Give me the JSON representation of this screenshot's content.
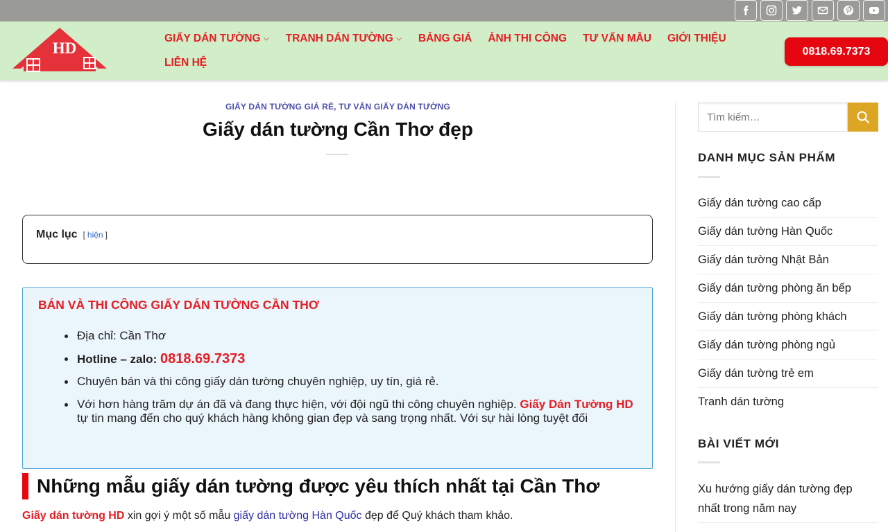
{
  "topbar": {
    "social": [
      {
        "icon": "facebook-icon",
        "name": "social-facebook"
      },
      {
        "icon": "instagram-icon",
        "name": "social-instagram"
      },
      {
        "icon": "twitter-icon",
        "name": "social-twitter"
      },
      {
        "icon": "email-icon",
        "name": "social-email"
      },
      {
        "icon": "pinterest-icon",
        "name": "social-pinterest"
      },
      {
        "icon": "youtube-icon",
        "name": "social-youtube"
      }
    ]
  },
  "header": {
    "logo_text": "HD",
    "nav": [
      {
        "label": "GIẤY DÁN TƯỜNG",
        "has_dropdown": true
      },
      {
        "label": "TRANH DÁN TƯỜNG",
        "has_dropdown": true
      },
      {
        "label": "BẢNG GIÁ",
        "has_dropdown": false
      },
      {
        "label": "ẢNH THI CÔNG",
        "has_dropdown": false
      },
      {
        "label": "TƯ VẤN MẪU",
        "has_dropdown": false
      },
      {
        "label": "GIỚI THIỆU",
        "has_dropdown": false
      },
      {
        "label": "LIÊN HỆ",
        "has_dropdown": false
      }
    ],
    "hotline": "0818.69.7373"
  },
  "article": {
    "categories": "GIẤY DÁN TƯỜNG GIÁ RẺ, TƯ VẤN GIẤY DÁN TƯỜNG",
    "title": "Giấy dán tường Cần Thơ đẹp",
    "toc": {
      "title": "Mục lục",
      "open_bracket": "[",
      "toggle": "hiện",
      "close_bracket": "]"
    },
    "infobox": {
      "heading": "BÁN VÀ THI CÔNG GIẤY DÁN TƯỜNG CẦN THƠ",
      "address": "Địa chỉ: Cần Thơ",
      "hotline_label": "Hotline – zalo:",
      "hotline_number": "0818.69.7373",
      "item3": "Chuyên bán và thi công giấy dán tường chuyên nghiệp, uy tín, giá rẻ.",
      "item4_part1": "Với hơn hàng trăm dự án đã và đang thực hiện, với đội ngũ thi công chuyên nghiệp.",
      "item4_brand": "Giấy Dán Tường HD",
      "item4_part2": "tự tin mang đến cho quý khách hàng không gian đẹp và sang trọng nhất. Với sự hài lòng tuyệt đối"
    },
    "section_heading": "Những mẫu giấy dán tường được yêu thích nhất tại Cần Thơ",
    "intro": {
      "brand": "Giấy dán tường HD",
      "text1": "xin gợi ý một số mẫu",
      "link": "giấy dán tường Hàn Quốc",
      "text2": "đẹp để Quý khách tham khảo."
    }
  },
  "sidebar": {
    "search_placeholder": "Tìm kiếm…",
    "categories_title": "DANH MỤC SẢN PHẨM",
    "categories": [
      "Giấy dán tường cao cấp",
      "Giấy dán tường Hàn Quốc",
      "Giấy dán tường Nhật Bản",
      "Giấy dán tường phòng ăn bếp",
      "Giấy dán tường phòng khách",
      "Giấy dán tường phòng ngủ",
      "Giấy dán tường trẻ em",
      "Tranh dán tường"
    ],
    "recent_title": "BÀI VIẾT MỚI",
    "recent_posts": [
      "Xu hướng giấy dán tường đẹp nhất trong năm nay"
    ]
  },
  "colors": {
    "topbar": "#9a9b97",
    "header_bg": "#d2eec9",
    "brand_red": "#e31e24",
    "hotline_btn": "#e5060f",
    "search_btn": "#dca524",
    "infobox_bg": "#ebf5fc",
    "infobox_border": "#4aa3d8",
    "category_text": "#4c4fad"
  }
}
